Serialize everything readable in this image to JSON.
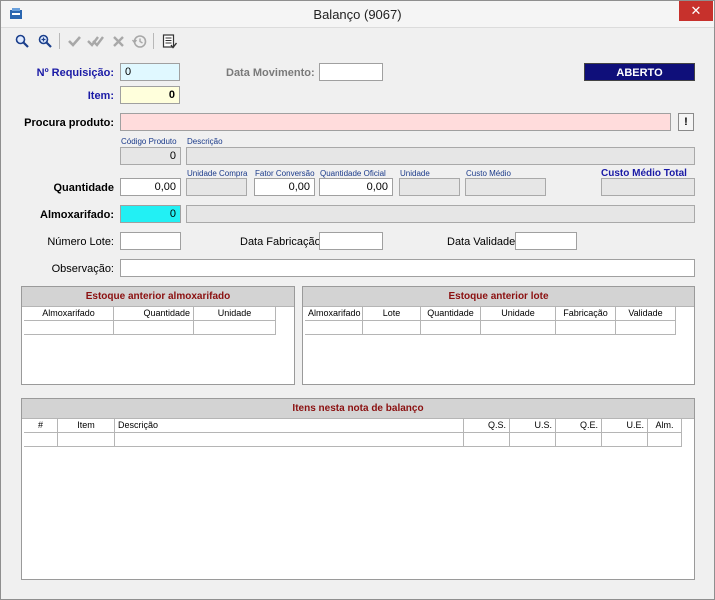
{
  "window": {
    "title": "Balanço (9067)",
    "close_label": "✕"
  },
  "toolbar": {
    "icons": [
      "search-icon",
      "search-plus-icon",
      "check-icon",
      "double-check-icon",
      "cancel-icon",
      "history-icon",
      "report-icon"
    ]
  },
  "form": {
    "requisicao": {
      "label": "Nº Requisição:",
      "value": "0"
    },
    "data_movimento": {
      "label": "Data Movimento:",
      "value": ""
    },
    "status": "ABERTO",
    "item": {
      "label": "Item:",
      "value": "0"
    },
    "procura_produto": {
      "label": "Procura produto:",
      "value": "",
      "button_label": "!"
    },
    "codigo_produto": {
      "label": "Código Produto",
      "value": "0"
    },
    "descricao": {
      "label": "Descrição",
      "value": ""
    },
    "quantidade": {
      "label": "Quantidade",
      "value": "0,00"
    },
    "unidade_compra": {
      "label": "Unidade Compra",
      "value": ""
    },
    "fator_conversao": {
      "label": "Fator Conversão",
      "value": "0,00"
    },
    "quantidade_oficial": {
      "label": "Quantidade Oficial",
      "value": "0,00"
    },
    "unidade": {
      "label": "Unidade",
      "value": ""
    },
    "custo_medio": {
      "label": "Custo Médio",
      "value": ""
    },
    "custo_medio_total": {
      "label": "Custo Médio Total",
      "value": ""
    },
    "almoxarifado": {
      "label": "Almoxarifado:",
      "value": "0",
      "desc": ""
    },
    "numero_lote": {
      "label": "Número Lote:",
      "value": ""
    },
    "data_fabricacao": {
      "label": "Data Fabricação:",
      "value": ""
    },
    "data_validade": {
      "label": "Data Validade:",
      "value": ""
    },
    "observacao": {
      "label": "Observação:",
      "value": ""
    }
  },
  "panels": {
    "estoque_almox": {
      "title": "Estoque anterior almoxarifado",
      "columns": [
        "Almoxarifado",
        "Quantidade",
        "Unidade"
      ]
    },
    "estoque_lote": {
      "title": "Estoque anterior lote",
      "columns": [
        "Almoxarifado",
        "Lote",
        "Quantidade",
        "Unidade",
        "Fabricação",
        "Validade"
      ]
    },
    "itens": {
      "title": "Itens nesta nota de balanço",
      "columns": [
        "#",
        "Item",
        "Descrição",
        "Q.S.",
        "U.S.",
        "Q.E.",
        "U.E.",
        "Alm."
      ]
    }
  },
  "colors": {
    "status_bg": "#0f0f7a",
    "label_blue": "#1a1aa6",
    "panel_title": "#8b1010",
    "close_red": "#c7312c"
  }
}
